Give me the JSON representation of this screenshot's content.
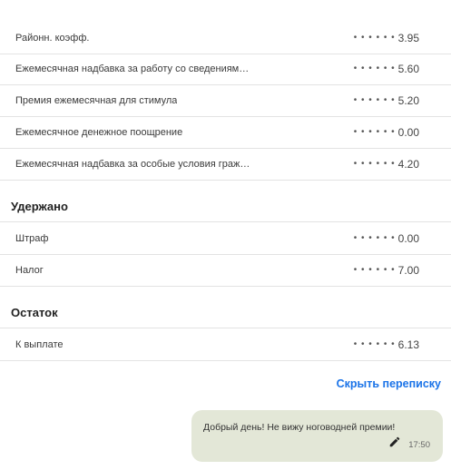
{
  "accruals": [
    {
      "label": "Районн. коэфф.",
      "dots": "• • • • • •",
      "value": "3.95"
    },
    {
      "label": "Ежемесячная надбавка за работу со сведениями, сост...",
      "dots": "• • • • • •",
      "value": "5.60"
    },
    {
      "label": "Премия ежемесячная для стимула",
      "dots": "• • • • • •",
      "value": "5.20"
    },
    {
      "label": "Ежемесячное денежное поощрение",
      "dots": "• • • • • •",
      "value": "0.00"
    },
    {
      "label": "Ежемесячная надбавка за особые условия гражданск...",
      "dots": "• • • • • •",
      "value": "4.20"
    }
  ],
  "withheld": {
    "title": "Удержано",
    "rows": [
      {
        "label": "Штраф",
        "dots": "• • • • • •",
        "value": "0.00"
      },
      {
        "label": "Налог",
        "dots": "• • • • • •",
        "value": "7.00"
      }
    ]
  },
  "balance": {
    "title": "Остаток",
    "rows": [
      {
        "label": "К выплате",
        "dots": "• • • • • •",
        "value": "6.13"
      }
    ]
  },
  "chat": {
    "hide_label": "Скрыть переписку",
    "message": "Добрый день! Не вижу ноговодней премии!",
    "time": "17:50",
    "edit_icon": "pencil-icon"
  }
}
